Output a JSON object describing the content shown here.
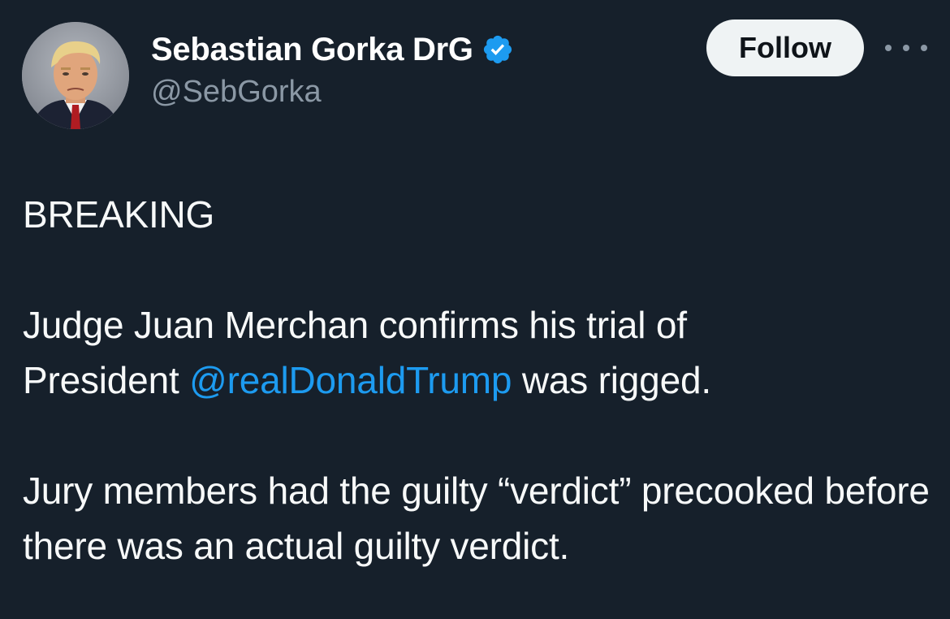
{
  "author": {
    "display_name": "Sebastian Gorka DrG",
    "handle": "@SebGorka",
    "verified_icon": "verified-badge-icon",
    "avatar_icon": "avatar"
  },
  "actions": {
    "follow_label": "Follow",
    "more_icon": "more-horizontal-icon"
  },
  "tweet": {
    "line1": "BREAKING",
    "paragraph2_part1": "Judge Juan Merchan confirms his trial of",
    "paragraph2_part2": "President ",
    "mention": "@realDonaldTrump",
    "paragraph2_part3": " was rigged.",
    "paragraph3": "Jury members had the guilty “verdict” precooked before there was an actual guilty verdict."
  },
  "colors": {
    "background": "#16202b",
    "text": "#f7f9f9",
    "secondary_text": "#8b98a5",
    "link": "#1d9bf0",
    "verified": "#1d9bf0",
    "follow_bg": "#eff3f4"
  }
}
